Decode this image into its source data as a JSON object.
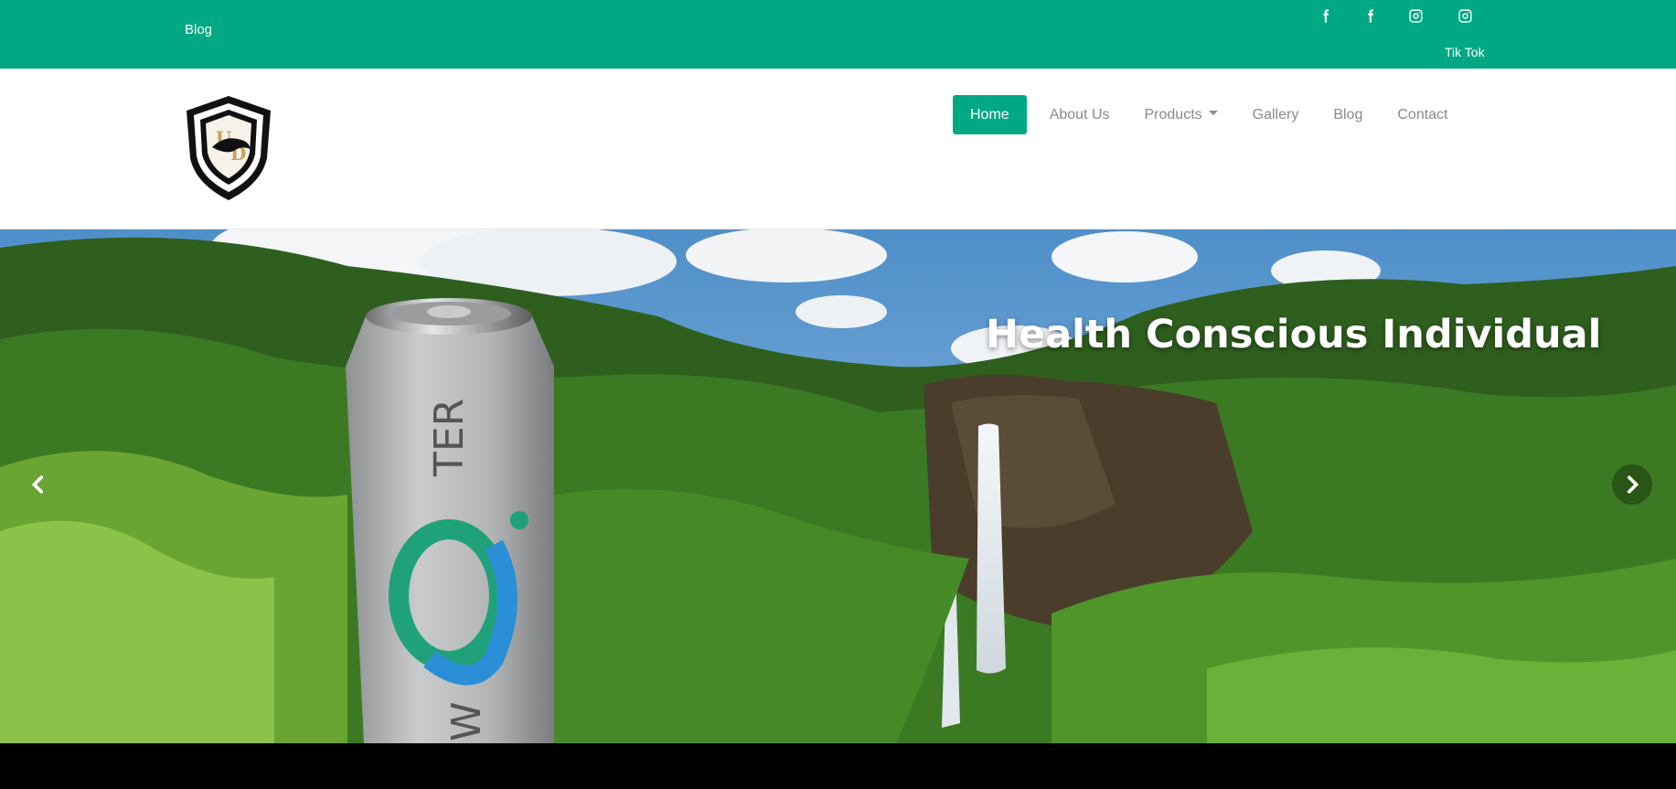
{
  "topbar": {
    "blog_label": "Blog",
    "tiktok_label": "Tik Tok",
    "social_icons": [
      "facebook-icon",
      "facebook-icon",
      "instagram-icon",
      "instagram-icon"
    ],
    "color": "#00a983"
  },
  "nav": {
    "items": [
      {
        "label": "Home",
        "active": true
      },
      {
        "label": "About Us"
      },
      {
        "label": "Products",
        "dropdown": true
      },
      {
        "label": "Gallery"
      },
      {
        "label": "Blog"
      },
      {
        "label": "Contact"
      }
    ]
  },
  "hero": {
    "headline": "Health Conscious Individual",
    "prev_icon": "chevron-left-icon",
    "next_icon": "chevron-right-icon"
  }
}
